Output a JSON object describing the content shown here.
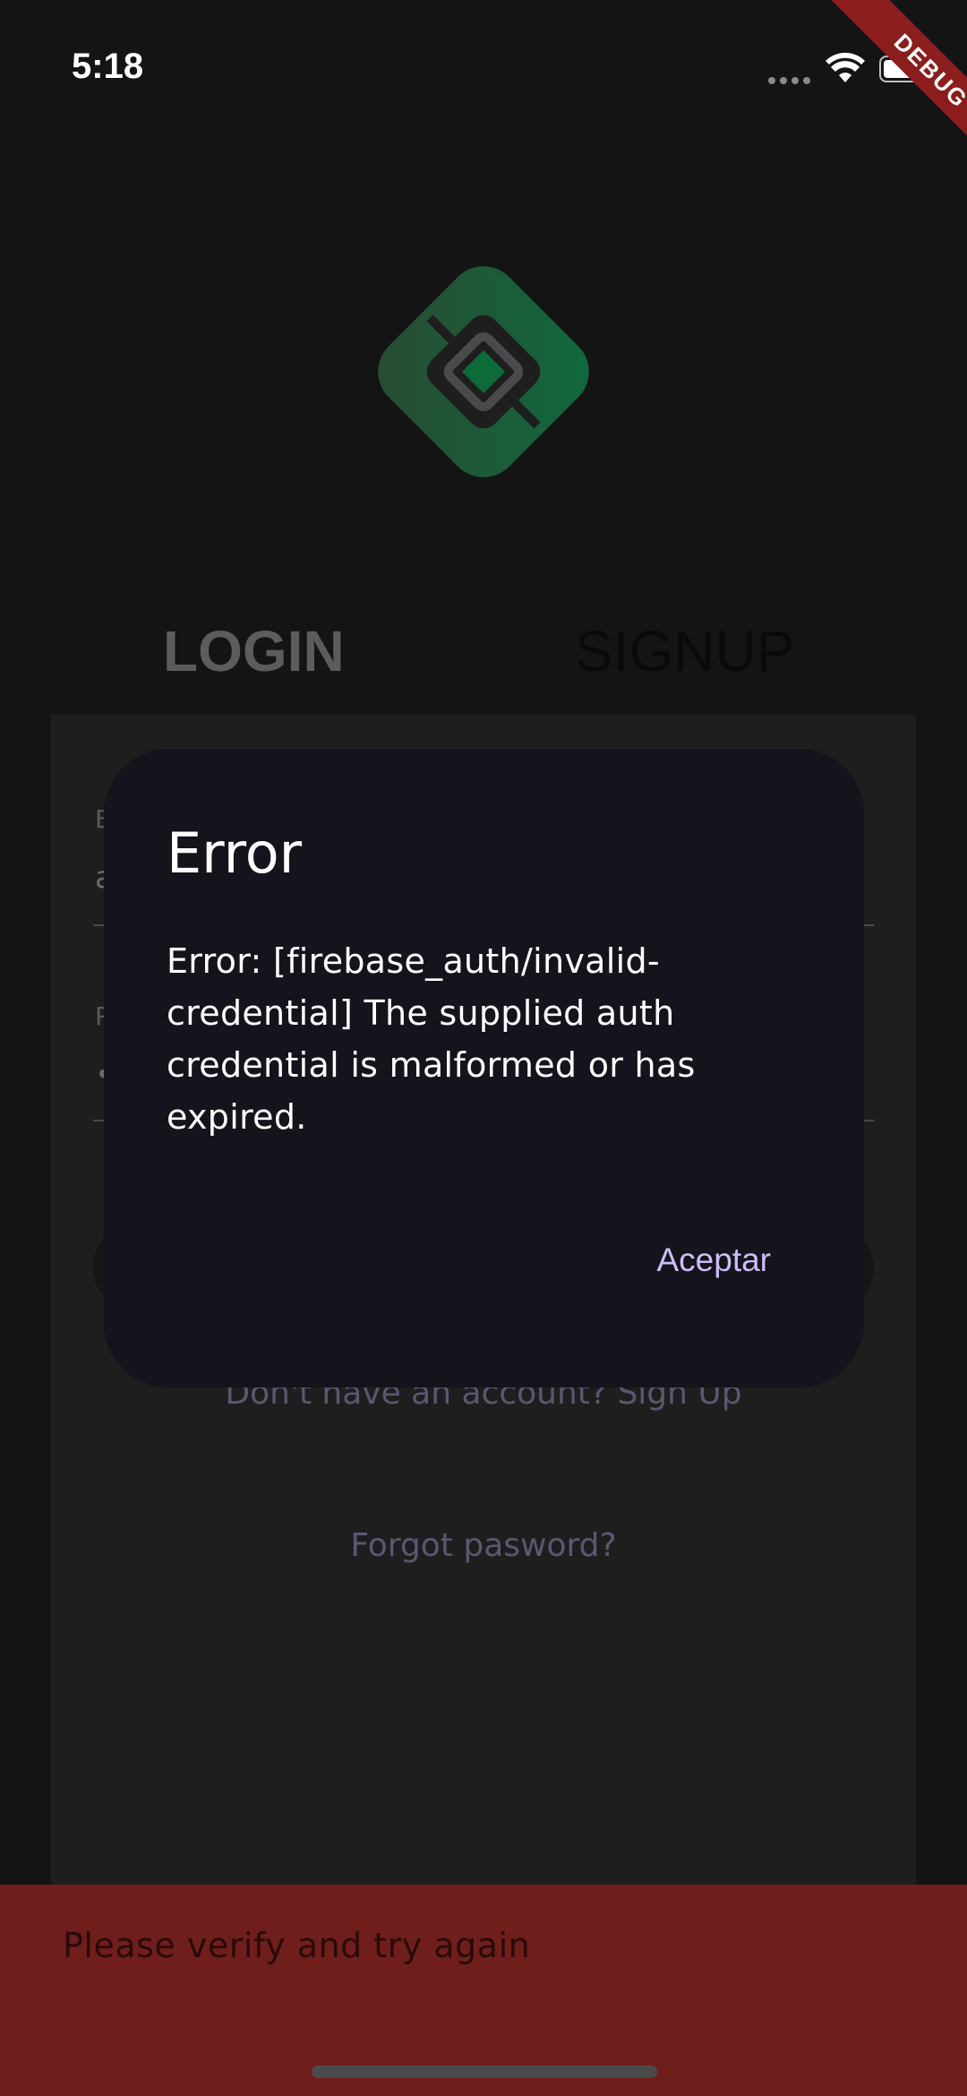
{
  "status_bar": {
    "time": "5:18"
  },
  "debug_banner": {
    "label": "DEBUG"
  },
  "logo": {
    "icon": "app-logo-diamond",
    "color": "#0d6b3a"
  },
  "tabs": {
    "login_label": "LOGIN",
    "signup_label": "SIGNUP"
  },
  "form": {
    "email_label": "E",
    "email_value": "a",
    "password_label": "P",
    "password_value": "•",
    "signup_link": "Don't have an account? Sign Up",
    "forgot_link": "Forgot pasword?"
  },
  "dialog": {
    "title": "Error",
    "message": "Error: [firebase_auth/invalid-credential] The supplied auth credential is malformed or has expired.",
    "action_label": "Aceptar",
    "accent": "#cdbdf6"
  },
  "snackbar": {
    "message": "Please verify and try again",
    "color": "#6f1e1b"
  }
}
